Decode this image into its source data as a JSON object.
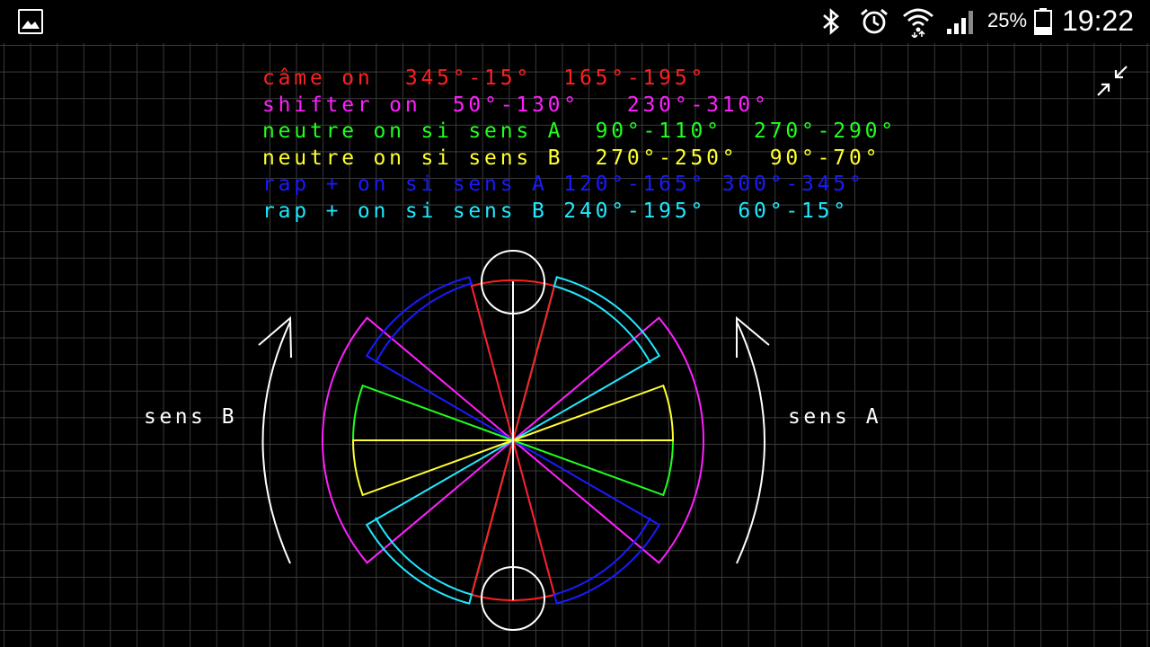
{
  "status_bar": {
    "notification_icon": "gallery-image-icon",
    "icons": [
      "bluetooth-icon",
      "alarm-icon",
      "wifi-icon",
      "signal-icon",
      "battery-icon"
    ],
    "battery": "25%",
    "time": "19:22"
  },
  "toolbar": {
    "collapse_icon": "collapse-arrows-icon"
  },
  "legend": [
    {
      "text": "câme on  345°-15°  165°-195°",
      "color": "#ff2020"
    },
    {
      "text": "shifter on  50°-130°   230°-310°",
      "color": "#ff20ff"
    },
    {
      "text": "neutre on si sens A  90°-110°  270°-290°",
      "color": "#20ff20"
    },
    {
      "text": "neutre on si sens B  270°-250°  90°-70°",
      "color": "#ffff30"
    },
    {
      "text": "rap + on si sens A 120°-165° 300°-345°",
      "color": "#1a1aff"
    },
    {
      "text": "rap + on si sens B 240°-195°  60°-15°",
      "color": "#20e8ff"
    }
  ],
  "labels": {
    "sens_b": "sens B",
    "sens_a": "sens A"
  },
  "colors": {
    "came": "#ff2020",
    "shifter": "#ff20ff",
    "neutre_a": "#20ff20",
    "neutre_b": "#ffff30",
    "rap_a": "#1a1aff",
    "rap_b": "#20e8ff",
    "white": "#ffffff"
  }
}
